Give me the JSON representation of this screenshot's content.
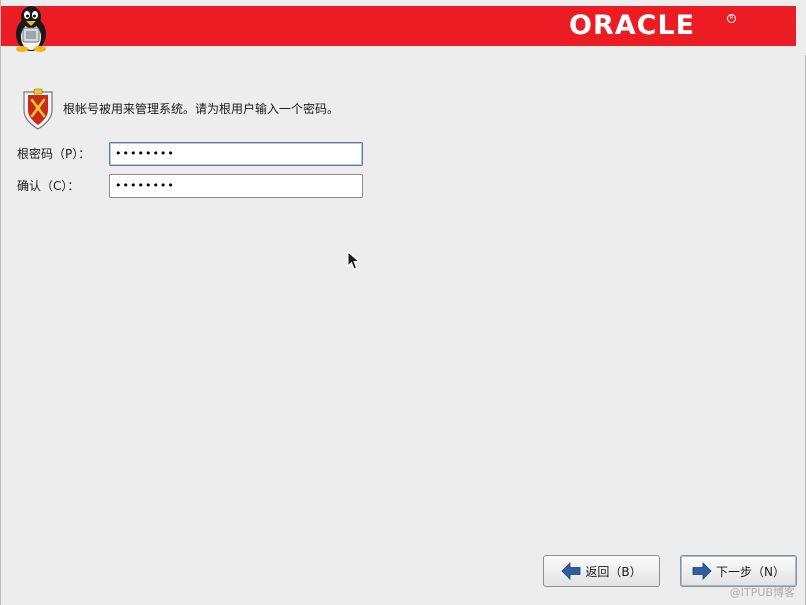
{
  "header": {
    "brand": "ORACLE",
    "brand_reg": "R",
    "tux_icon": "tux-icon"
  },
  "info": {
    "icon": "root-shield-icon",
    "text": "根帐号被用来管理系统。请为根用户输入一个密码。"
  },
  "form": {
    "password_label": "根密码（P）：",
    "password_value": "••••••••",
    "confirm_label": "确认（C）：",
    "confirm_value": "••••••••"
  },
  "buttons": {
    "back_label": "返回（B）",
    "next_label": "下一步（N）"
  },
  "watermark": "@ITPUB博客",
  "colors": {
    "banner": "#ec1c24",
    "background": "#ededed",
    "arrow": "#2f5f9e"
  }
}
